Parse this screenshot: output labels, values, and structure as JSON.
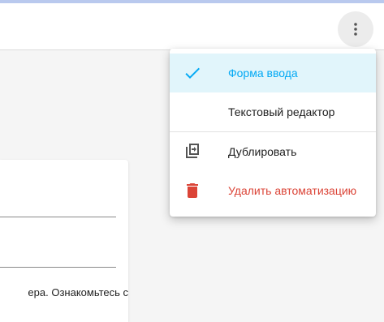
{
  "header": {
    "more_icon": "more-vertical-icon"
  },
  "card": {
    "text": "ера. Ознакомьтесь с"
  },
  "menu": {
    "items": [
      {
        "label": "Форма ввода",
        "icon": "check-icon",
        "selected": true
      },
      {
        "label": "Текстовый редактор",
        "icon": "",
        "selected": false
      },
      {
        "label": "Дублировать",
        "icon": "duplicate-icon",
        "selected": false
      },
      {
        "label": "Удалить автоматизацию",
        "icon": "trash-icon",
        "selected": false
      }
    ]
  },
  "colors": {
    "accent": "#03a9f4",
    "selected_bg": "#e1f5fb",
    "danger": "#db4437",
    "text": "#212121",
    "icon": "#555555"
  }
}
